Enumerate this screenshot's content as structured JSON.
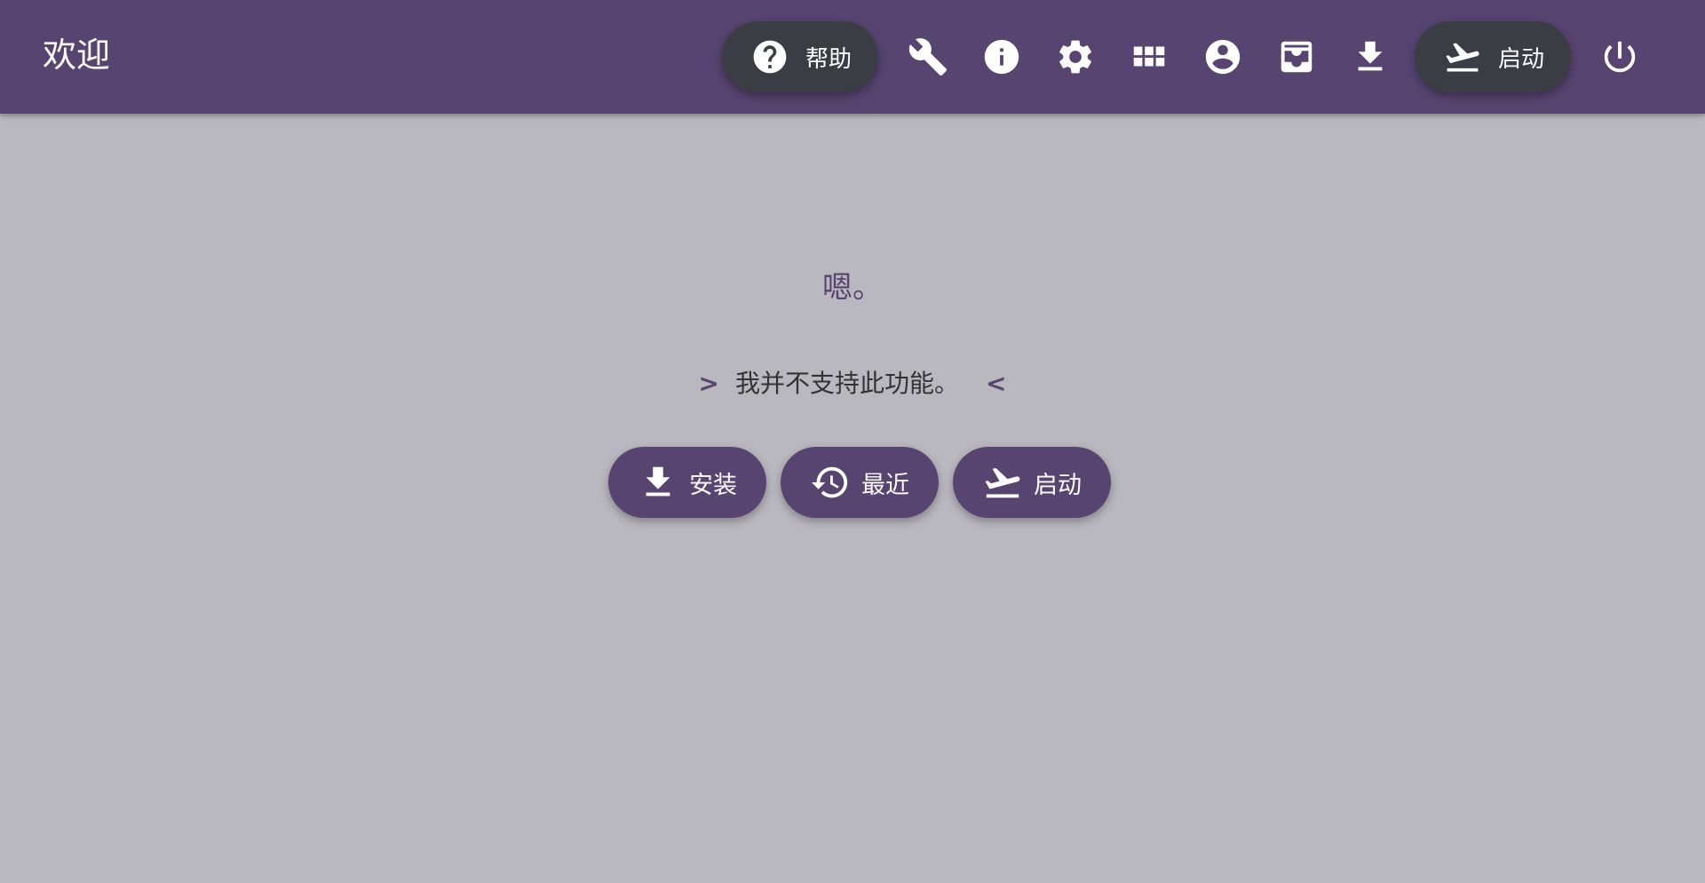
{
  "header": {
    "title": "欢迎",
    "help_label": "帮助",
    "launch_label": "启动",
    "icons": [
      "help-icon",
      "wrench-icon",
      "info-icon",
      "gear-icon",
      "apps-grid-icon",
      "account-icon",
      "inbox-icon",
      "download-icon",
      "flight-takeoff-icon",
      "power-icon"
    ]
  },
  "main": {
    "heading": "嗯。",
    "arrow_left": ">",
    "message": "我并不支持此功能。",
    "arrow_right": "<",
    "buttons": {
      "install": "安装",
      "recent": "最近",
      "launch": "启动"
    }
  },
  "colors": {
    "primary": "#574470",
    "background": "#b9b8be",
    "pill_dark": "#3a3e44",
    "text": "#333333"
  }
}
